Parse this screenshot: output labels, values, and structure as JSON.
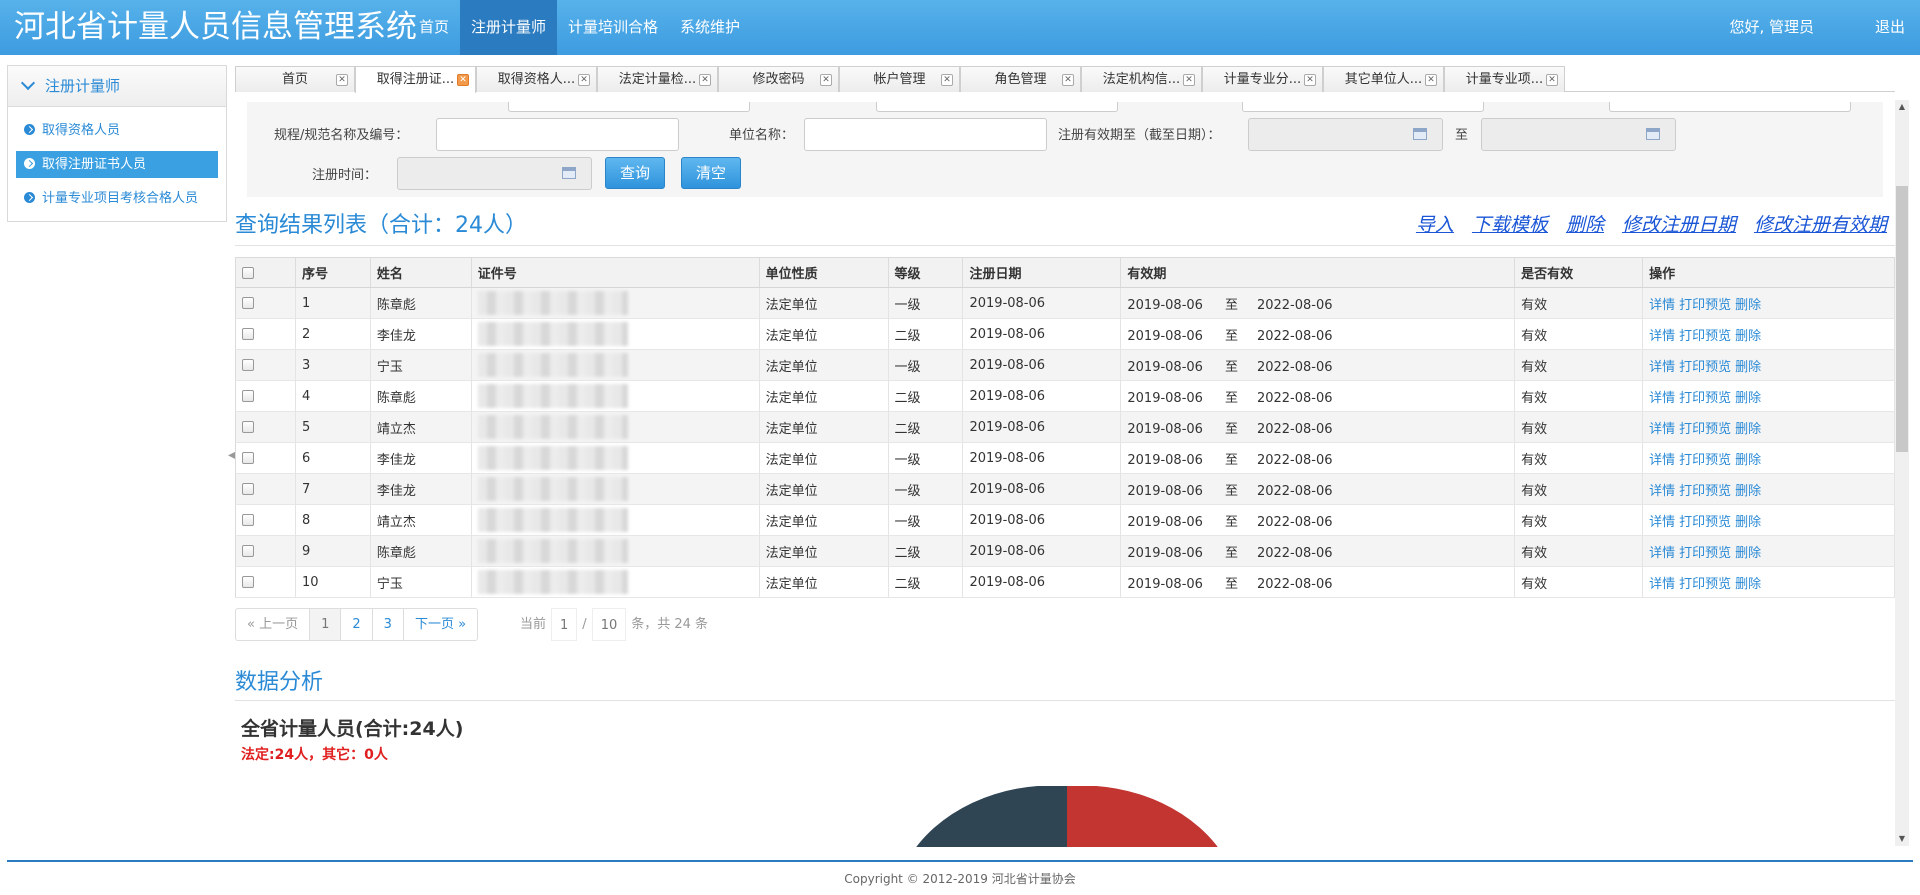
{
  "app": {
    "title": "河北省计量人员信息管理系统",
    "greeting": "您好, 管理员",
    "logout": "退出"
  },
  "topnav": [
    "首页",
    "注册计量师",
    "计量培训合格",
    "系统维护"
  ],
  "sidebar": {
    "header": "注册计量师",
    "items": [
      "取得资格人员",
      "取得注册证书人员",
      "计量专业项目考核合格人员"
    ]
  },
  "tabs": [
    "首页",
    "取得注册证...",
    "取得资格人...",
    "法定计量检...",
    "修改密码",
    "帐户管理",
    "角色管理",
    "法定机构信...",
    "计量专业分...",
    "其它单位人...",
    "计量专业项..."
  ],
  "search": {
    "rule_label": "规程/规范名称及编号：",
    "unit_label": "单位名称：",
    "valid_label": "注册有效期至（截至日期）：",
    "to": "至",
    "regtime_label": "注册时间：",
    "query": "查询",
    "clear": "清空"
  },
  "result": {
    "title": "查询结果列表（合计：24人）",
    "links": [
      "导入",
      "下载模板",
      "删除",
      "修改注册日期",
      "修改注册有效期"
    ]
  },
  "table": {
    "headers": [
      "序号",
      "姓名",
      "证件号",
      "单位性质",
      "等级",
      "注册日期",
      "有效期",
      "是否有效",
      "操作"
    ],
    "to": "至",
    "ops": [
      "详情",
      "打印预览",
      "删除"
    ],
    "rows": [
      {
        "no": "1",
        "name": "陈章彪",
        "unit": "法定单位",
        "level": "一级",
        "reg": "2019-08-06",
        "from": "2019-08-06",
        "until": "2022-08-06",
        "valid": "有效"
      },
      {
        "no": "2",
        "name": "李佳龙",
        "unit": "法定单位",
        "level": "二级",
        "reg": "2019-08-06",
        "from": "2019-08-06",
        "until": "2022-08-06",
        "valid": "有效"
      },
      {
        "no": "3",
        "name": "宁玉",
        "unit": "法定单位",
        "level": "一级",
        "reg": "2019-08-06",
        "from": "2019-08-06",
        "until": "2022-08-06",
        "valid": "有效"
      },
      {
        "no": "4",
        "name": "陈章彪",
        "unit": "法定单位",
        "level": "二级",
        "reg": "2019-08-06",
        "from": "2019-08-06",
        "until": "2022-08-06",
        "valid": "有效"
      },
      {
        "no": "5",
        "name": "靖立杰",
        "unit": "法定单位",
        "level": "二级",
        "reg": "2019-08-06",
        "from": "2019-08-06",
        "until": "2022-08-06",
        "valid": "有效"
      },
      {
        "no": "6",
        "name": "李佳龙",
        "unit": "法定单位",
        "level": "一级",
        "reg": "2019-08-06",
        "from": "2019-08-06",
        "until": "2022-08-06",
        "valid": "有效"
      },
      {
        "no": "7",
        "name": "李佳龙",
        "unit": "法定单位",
        "level": "一级",
        "reg": "2019-08-06",
        "from": "2019-08-06",
        "until": "2022-08-06",
        "valid": "有效"
      },
      {
        "no": "8",
        "name": "靖立杰",
        "unit": "法定单位",
        "level": "一级",
        "reg": "2019-08-06",
        "from": "2019-08-06",
        "until": "2022-08-06",
        "valid": "有效"
      },
      {
        "no": "9",
        "name": "陈章彪",
        "unit": "法定单位",
        "level": "二级",
        "reg": "2019-08-06",
        "from": "2019-08-06",
        "until": "2022-08-06",
        "valid": "有效"
      },
      {
        "no": "10",
        "name": "宁玉",
        "unit": "法定单位",
        "level": "二级",
        "reg": "2019-08-06",
        "from": "2019-08-06",
        "until": "2022-08-06",
        "valid": "有效"
      }
    ]
  },
  "pager": {
    "prev": "« 上一页",
    "pages": [
      "1",
      "2",
      "3"
    ],
    "next": "下一页 »",
    "current_label": "当前",
    "current": "1",
    "sep": "/",
    "total_pages": "10",
    "suffix": "条，共 24 条"
  },
  "analysis": {
    "title": "数据分析",
    "stat_title": "全省计量人员(合计:24人)",
    "stat_sub": "法定:24人，其它：0人"
  },
  "colors": {
    "pie_left": "#2f4554",
    "pie_right": "#c23531",
    "accent": "#2a8ad6"
  },
  "footer": "Copyright © 2012-2019 河北省计量协会"
}
